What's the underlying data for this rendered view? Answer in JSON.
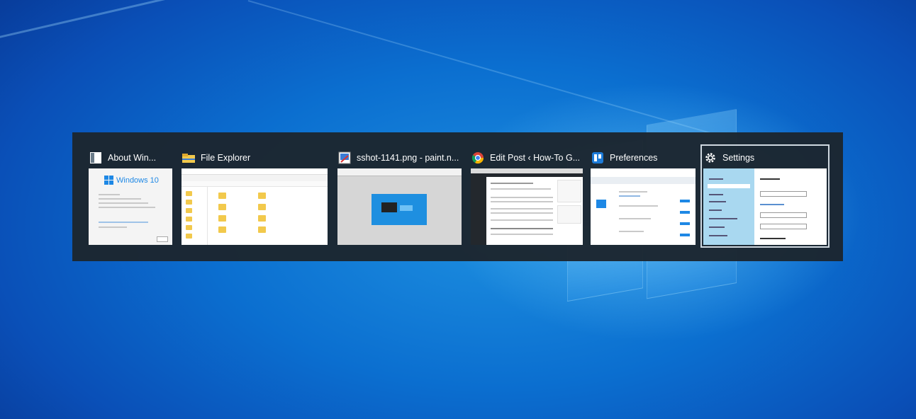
{
  "desktop": {
    "background_colors": [
      "#0a4fb7",
      "#1d8fe0",
      "#083d9c"
    ]
  },
  "switcher": {
    "windows": [
      {
        "title": "About Win...",
        "icon": "about-windows-icon",
        "thumb_text": "Windows 10"
      },
      {
        "title": "File Explorer",
        "icon": "folder-icon"
      },
      {
        "title": "sshot-1141.png - paint.n...",
        "icon": "paint-net-icon"
      },
      {
        "title": "Edit Post ‹ How-To G...",
        "icon": "chrome-icon"
      },
      {
        "title": "Preferences",
        "icon": "trello-icon"
      },
      {
        "title": "Settings",
        "icon": "gear-icon",
        "selected": true
      }
    ]
  }
}
